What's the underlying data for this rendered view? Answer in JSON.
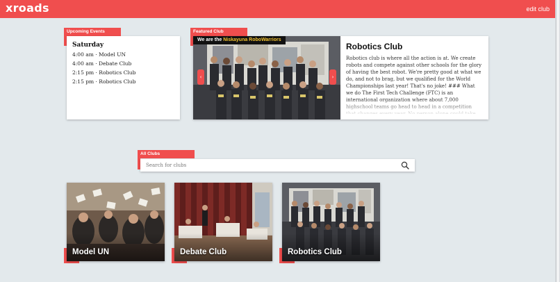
{
  "app": {
    "logo": "xroads",
    "edit_label": "edit club"
  },
  "upcoming": {
    "tag": "Upcoming Events",
    "day": "Saturday",
    "events": [
      "4:00 am · Model UN",
      "4:00 am · Debate Club",
      "2:15 pm · Robotics Club",
      "2:15 pm · Robotics Club"
    ]
  },
  "featured": {
    "tag": "Featured Club",
    "banner_prefix": "We are the ",
    "banner_highlight": "Niskayuna RoboWarriors",
    "title": "Robotics Club",
    "description": "Robotics club is where all the action is at. We create robots and compete against other schools for the glory of having the best robot. We're pretty good at what we do, and not to brag, but we qualified for the World Championships last year! That's no joke! ### What we do The First Tech Challenge (FTC) is an international organization where about 7,000 highschool teams go head to head in a competition that changes every year. No person alone could take on such an immense feat.",
    "prev_icon": "‹",
    "next_icon": "›"
  },
  "all_clubs": {
    "tag": "All Clubs",
    "search_placeholder": "Search for clubs",
    "clubs": [
      {
        "name": "Model UN"
      },
      {
        "name": "Debate Club"
      },
      {
        "name": "Robotics Club"
      }
    ]
  },
  "colors": {
    "accent": "#f04e4e",
    "background": "#e3e9ec",
    "banner_highlight": "#f2c230"
  }
}
